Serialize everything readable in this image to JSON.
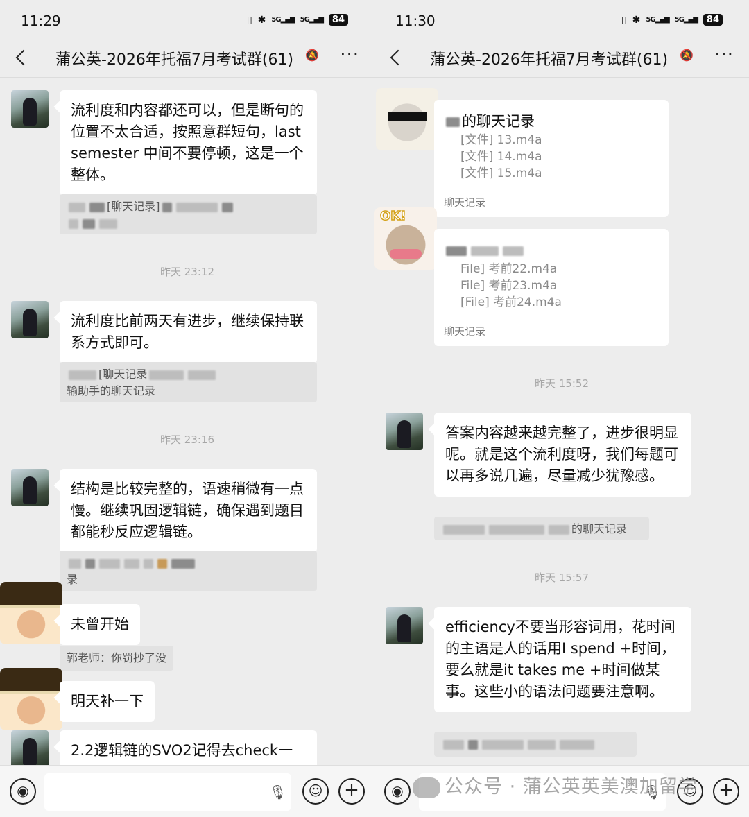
{
  "left": {
    "status": {
      "time": "11:29",
      "battery": "84"
    },
    "header": {
      "title": "蒲公英-2026年托福7月考试群(61)"
    },
    "messages": {
      "m1": "流利度和内容都还可以，但是断句的位置不太合适，按照意群短句，last semester 中间不要停顿，这是一个整体。",
      "q1": "[聊天记录]",
      "ts1": "昨天 23:12",
      "m2": "流利度比前两天有进步，继续保持联系方式即可。",
      "q2a": "[聊天记录",
      "q2b": "输助手的聊天记录",
      "ts2": "昨天 23:16",
      "m3": "结构是比较完整的，语速稍微有一点慢。继续巩固逻辑链，确保遇到题目都能秒反应逻辑链。",
      "q3": "录",
      "m4": "未曾开始",
      "q4": "郭老师：你罚抄了没",
      "m5": "明天补一下",
      "m6": "2.2逻辑链的SVO2记得去check一"
    }
  },
  "right": {
    "status": {
      "time": "11:30",
      "battery": "84"
    },
    "header": {
      "title": "蒲公英-2026年托福7月考试群(61)"
    },
    "stickers": {
      "ok_label": "OK!"
    },
    "cards": {
      "c1_title": "的聊天记录",
      "c1_lines": [
        "[文件] 13.m4a",
        "[文件] 14.m4a",
        "[文件] 15.m4a"
      ],
      "c1_foot": "聊天记录",
      "c2_lines": [
        "File] 考前22.m4a",
        "File] 考前23.m4a",
        "[File] 考前24.m4a"
      ],
      "c2_foot": "聊天记录"
    },
    "messages": {
      "ts1": "昨天 15:52",
      "m1": "答案内容越来越完整了，进步很明显呢。就是这个流利度呀，我们每题可以再多说几遍，尽量减少犹豫感。",
      "q1": "的聊天记录",
      "ts2": "昨天 15:57",
      "m2": "efficiency不要当形容词用，花时间的主语是人的话用I spend +时间，要么就是it takes me +时间做某事。这些小的语法问题要注意啊。"
    }
  },
  "watermark": "公众号 · 蒲公英英美澳加留学",
  "icons": [
    "back-icon",
    "mute-bell-icon",
    "more-icon",
    "voice-icon",
    "mic-icon",
    "emoji-icon",
    "plus-icon"
  ]
}
